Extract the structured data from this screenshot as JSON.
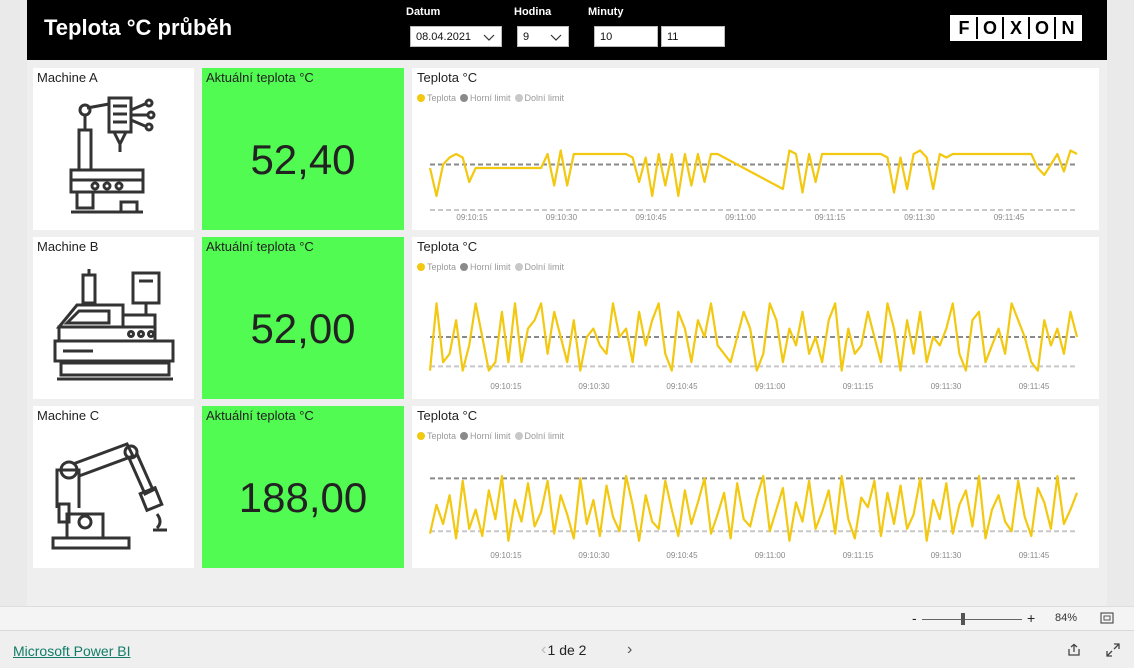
{
  "header": {
    "title": "Teplota °C průběh",
    "filters": [
      {
        "label": "Datum",
        "value": "08.04.2021"
      },
      {
        "label": "Hodina",
        "value": "9"
      },
      {
        "label": "Minuty",
        "value_from": "10",
        "value_to": "11"
      }
    ],
    "logo_letters": [
      "F",
      "O",
      "X",
      "O",
      "N"
    ]
  },
  "machines": [
    {
      "name": "Machine A",
      "gauge_label": "Aktuální teplota °C",
      "gauge_value": "52,40",
      "icon": "drill-press-icon"
    },
    {
      "name": "Machine B",
      "gauge_label": "Aktuální teplota °C",
      "gauge_value": "52,00",
      "icon": "cnc-machine-icon"
    },
    {
      "name": "Machine C",
      "gauge_label": "Aktuální teplota °C",
      "gauge_value": "188,00",
      "icon": "robot-arm-icon"
    }
  ],
  "chart_common": {
    "title": "Teplota °C",
    "legend": [
      "Teplota",
      "Horní limit",
      "Dolní limit"
    ],
    "colors": {
      "teplota": "#f2c811",
      "horni": "#8a8a8a",
      "dolni": "#c8c8c8"
    },
    "x_ticks": [
      "09:10:15",
      "09:10:30",
      "09:10:45",
      "09:11:00",
      "09:11:15",
      "09:11:30",
      "09:11:45"
    ]
  },
  "chart_data": [
    {
      "type": "line",
      "title": "Teplota °C",
      "x_range": [
        "09:10:00",
        "09:11:59"
      ],
      "ylim": [
        40,
        64
      ],
      "series": [
        {
          "name": "Teplota",
          "values": [
            52,
            44,
            53,
            55,
            56,
            55,
            48,
            52,
            52,
            52,
            52,
            52,
            52,
            52,
            52,
            52,
            52,
            52,
            56,
            47,
            57,
            47,
            56,
            56,
            56,
            56,
            56,
            56,
            56,
            56,
            56,
            55,
            48,
            55,
            44,
            56,
            47,
            56,
            44,
            56,
            47,
            56,
            48,
            56,
            56,
            55,
            54,
            53,
            52,
            51,
            50,
            49,
            48,
            47,
            46,
            57,
            56,
            45,
            56,
            48,
            56,
            56,
            56,
            56,
            56,
            56,
            56,
            56,
            56,
            56,
            55,
            45,
            55,
            46,
            56,
            57,
            55,
            46,
            56,
            55,
            56,
            56,
            56,
            56,
            56,
            56,
            56,
            56,
            56,
            56,
            56,
            56,
            56,
            52,
            50,
            53,
            56,
            51,
            57,
            56
          ]
        },
        {
          "name": "Horní limit",
          "values": [
            53,
            53
          ]
        },
        {
          "name": "Dolní limit",
          "values": [
            40,
            40
          ]
        }
      ]
    },
    {
      "type": "line",
      "title": "Teplota °C",
      "x_range": [
        "09:10:00",
        "09:11:59"
      ],
      "ylim": [
        46,
        56
      ],
      "series": [
        {
          "name": "Teplota",
          "values": [
            47,
            55,
            48,
            49,
            53,
            47,
            50,
            55,
            51,
            47,
            48,
            54,
            48,
            55,
            48,
            52,
            53,
            55,
            49,
            54,
            51,
            48,
            53,
            47,
            51,
            52,
            50,
            49,
            55,
            51,
            52,
            48,
            54,
            50,
            53,
            55,
            49,
            47,
            54,
            52,
            48,
            53,
            51,
            55,
            50,
            49,
            48,
            51,
            54,
            52,
            47,
            49,
            55,
            53,
            48,
            52,
            50,
            54,
            49,
            51,
            48,
            53,
            55,
            47,
            52,
            49,
            50,
            54,
            51,
            48,
            55,
            52,
            47,
            53,
            49,
            54,
            48,
            51,
            50,
            52,
            55,
            49,
            47,
            53,
            54,
            48,
            50,
            52,
            49,
            55,
            53,
            51,
            48,
            47,
            53,
            50,
            52,
            49,
            54,
            51
          ]
        },
        {
          "name": "Horní limit",
          "values": [
            51,
            51
          ]
        },
        {
          "name": "Dolní limit",
          "values": [
            47.5,
            47.5
          ]
        }
      ]
    },
    {
      "type": "line",
      "title": "Teplota °C",
      "x_range": [
        "09:10:00",
        "09:11:59"
      ],
      "ylim": [
        160,
        195
      ],
      "series": [
        {
          "name": "Teplota",
          "values": [
            166,
            178,
            170,
            182,
            164,
            188,
            168,
            176,
            165,
            184,
            172,
            190,
            163,
            180,
            171,
            187,
            169,
            175,
            188,
            166,
            182,
            174,
            164,
            189,
            170,
            180,
            165,
            186,
            173,
            167,
            190,
            178,
            163,
            182,
            171,
            168,
            188,
            176,
            165,
            184,
            170,
            179,
            189,
            166,
            174,
            183,
            164,
            187,
            172,
            169,
            181,
            190,
            167,
            176,
            185,
            163,
            179,
            171,
            188,
            168,
            175,
            184,
            166,
            190,
            172,
            164,
            181,
            177,
            188,
            165,
            183,
            170,
            186,
            168,
            174,
            189,
            163,
            180,
            172,
            187,
            166,
            178,
            184,
            169,
            190,
            164,
            176,
            182,
            171,
            167,
            188,
            173,
            165,
            185,
            179,
            168,
            190,
            170,
            176,
            183
          ]
        },
        {
          "name": "Horní limit",
          "values": [
            189,
            189
          ]
        },
        {
          "name": "Dolní limit",
          "values": [
            167,
            167
          ]
        }
      ]
    }
  ],
  "zoom": {
    "minus": "-",
    "plus": "+",
    "level": "84%"
  },
  "footer": {
    "brand": "Microsoft Power BI",
    "page": "1 de 2"
  }
}
